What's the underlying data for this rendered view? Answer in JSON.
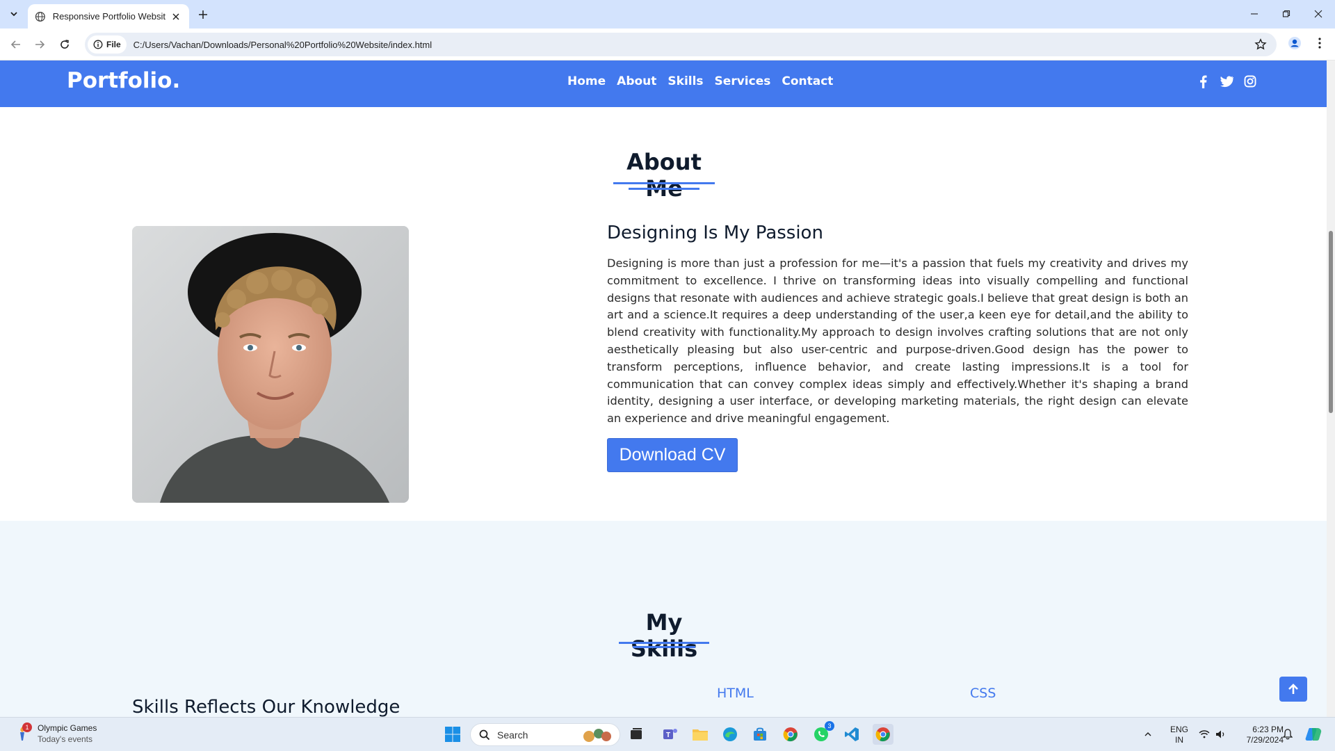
{
  "browser": {
    "tab_title": "Responsive Portfolio Website H",
    "site_chip_label": "File",
    "url": "C:/Users/Vachan/Downloads/Personal%20Portfolio%20Website/index.html"
  },
  "header": {
    "logo": "Portfolio.",
    "nav": [
      "Home",
      "About",
      "Skills",
      "Services",
      "Contact"
    ],
    "socials": [
      "facebook-icon",
      "twitter-icon",
      "instagram-icon"
    ],
    "brand_color": "#4379ee"
  },
  "about": {
    "title": "About Me",
    "subtitle": "Designing Is My Passion",
    "paragraph": "Designing is more than just a profession for me—it's a passion that fuels my creativity and drives my commitment to excellence. I thrive on transforming ideas into visually compelling and functional designs that resonate with audiences and achieve strategic goals.I believe that great design is both an art and a science.It requires a deep understanding of the user,a keen eye for detail,and the ability to blend creativity with functionality.My approach to design involves crafting solutions that are not only aesthetically pleasing but also user-centric and purpose-driven.Good design has the power to transform perceptions, influence behavior, and create lasting impressions.It is a tool for communication that can convey complex ideas simply and effectively.Whether it's shaping a brand identity, designing a user interface, or developing marketing materials, the right design can elevate an experience and drive meaningful engagement.",
    "cv_button": "Download CV"
  },
  "skills": {
    "title": "My Skills",
    "subtitle": "Skills Reflects Our Knowledge",
    "labels": [
      "HTML",
      "CSS"
    ]
  },
  "taskbar": {
    "weather_title": "Olympic Games",
    "weather_sub": "Today's events",
    "weather_badge": "1",
    "search_label": "Search",
    "whatsapp_badge": "3",
    "lang_top": "ENG",
    "lang_bottom": "IN",
    "time": "6:23 PM",
    "date": "7/29/2024"
  }
}
